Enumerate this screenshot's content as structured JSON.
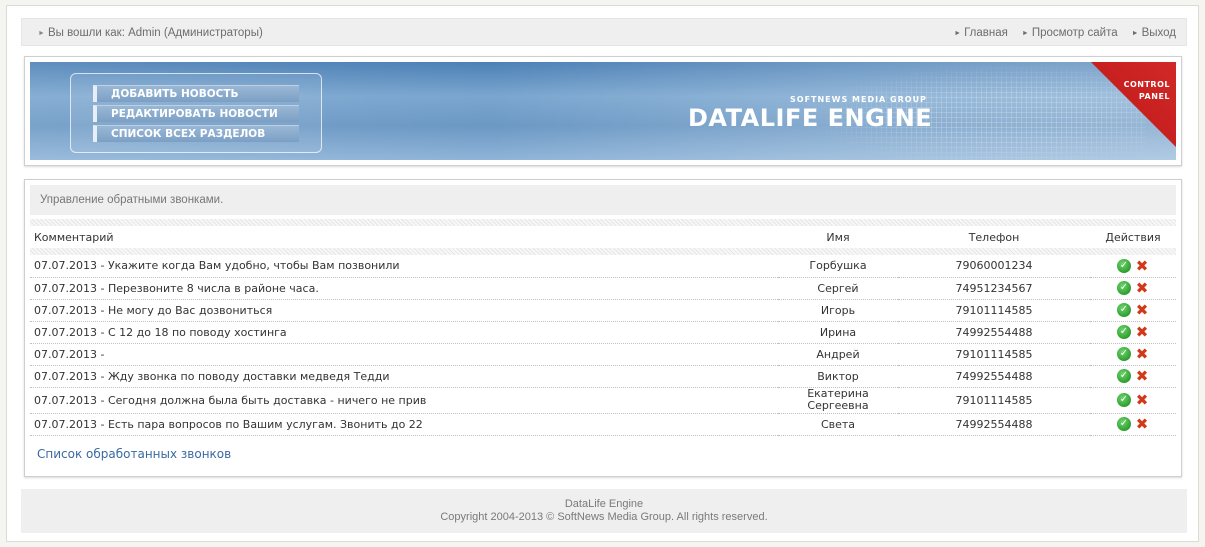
{
  "topbar": {
    "login_text": "Вы вошли как: Admin (Администраторы)",
    "links": [
      "Главная",
      "Просмотр сайта",
      "Выход"
    ]
  },
  "header": {
    "menu": [
      "ДОБАВИТЬ НОВОСТЬ",
      "РЕДАКТИРОВАТЬ НОВОСТИ",
      "СПИСОК ВСЕХ РАЗДЕЛОВ"
    ],
    "brand_small": "SOFTNEWS MEDIA GROUP",
    "brand_big": "DATALIFE ENGINE",
    "corner_line1": "CONTROL",
    "corner_line2": "PANEL"
  },
  "content": {
    "section_title": "Управление обратными звонками.",
    "columns": {
      "comment": "Комментарий",
      "name": "Имя",
      "phone": "Телефон",
      "actions": "Действия"
    },
    "rows": [
      {
        "comment": "07.07.2013 - Укажите когда Вам удобно, чтобы Вам позвонили",
        "name": "Горбушка",
        "phone": "79060001234"
      },
      {
        "comment": "07.07.2013 - Перезвоните 8 числа в районе часа.",
        "name": "Сергей",
        "phone": "74951234567"
      },
      {
        "comment": "07.07.2013 - Не могу до Вас дозвониться",
        "name": "Игорь",
        "phone": "79101114585"
      },
      {
        "comment": "07.07.2013 - С 12 до 18 по поводу хостинга",
        "name": "Ирина",
        "phone": "74992554488"
      },
      {
        "comment": "07.07.2013 -",
        "name": "Андрей",
        "phone": "79101114585"
      },
      {
        "comment": "07.07.2013 - Жду звонка по поводу доставки медведя Тедди",
        "name": "Виктор",
        "phone": "74992554488"
      },
      {
        "comment": "07.07.2013 - Сегодня должна была быть доставка - ничего не прив",
        "name": "Екатерина Сергеевна",
        "name_line1": "Екатерина",
        "name_line2": "Сергеевна",
        "phone": "79101114585"
      },
      {
        "comment": "07.07.2013 - Есть пара вопросов по Вашим услугам. Звонить до 22",
        "name": "Света",
        "phone": "74992554488"
      }
    ],
    "processed_link": "Список обработанных звонков"
  },
  "footer": {
    "line1": "DataLife Engine",
    "line2": "Copyright 2004-2013 © SoftNews Media Group. All rights reserved."
  },
  "icons": {
    "approve": "check-circle-icon",
    "delete": "red-x-icon"
  },
  "colors": {
    "banner_blue": "#6b98c4",
    "corner_red": "#c81f1f",
    "link_blue": "#3a6aa0",
    "approve_green": "#2e9f2e",
    "delete_red": "#d03a1a"
  }
}
